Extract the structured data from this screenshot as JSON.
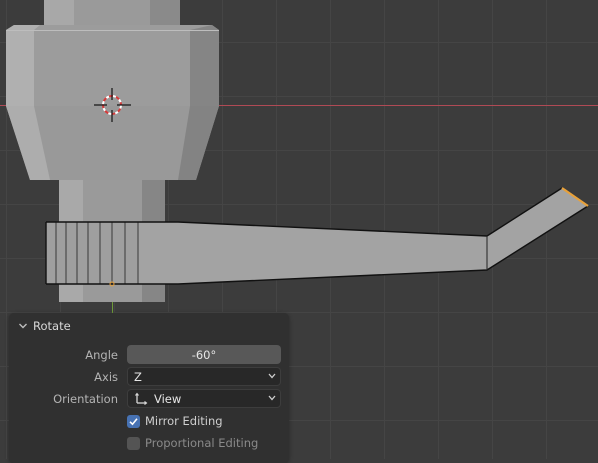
{
  "colors": {
    "viewport_bg": "#3c3c3c",
    "grid_line": "#444444",
    "x_axis": "#b04a55",
    "y_axis": "#6e9a3a",
    "mesh_face": "#9e9e9e",
    "selected_edge": "#e8a13a",
    "panel_bg": "#303030",
    "checkbox_on": "#4772b3"
  },
  "icons": {
    "cursor": "3d-cursor-icon",
    "collapse": "chevron-down-icon",
    "dropdown": "chevron-down-icon",
    "orientation": "orientation-gizmo-icon",
    "check": "checkmark-icon"
  },
  "operator_panel": {
    "title": "Rotate",
    "angle": {
      "label": "Angle",
      "value": "-60°"
    },
    "axis": {
      "label": "Axis",
      "value": "Z"
    },
    "orientation": {
      "label": "Orientation",
      "value": "View"
    },
    "mirror_editing": {
      "label": "Mirror Editing",
      "checked": true
    },
    "proportional_editing": {
      "label": "Proportional Editing",
      "checked": false
    }
  }
}
